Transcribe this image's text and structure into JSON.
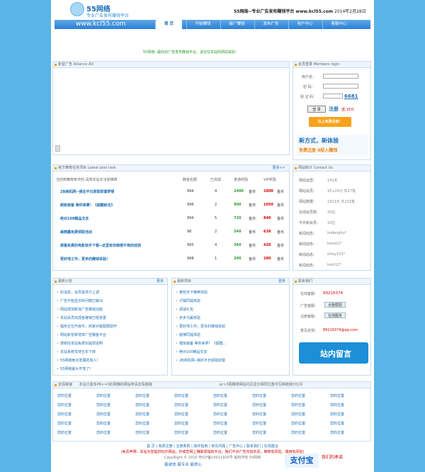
{
  "header": {
    "logo_name": "55网络",
    "logo_slogan": "专业广告发布赚钱平台",
    "tag_strong": "55网络--专业广告发布赚钱平台 www.kcl55.com",
    "tag_date": "2014年2月28日",
    "url": "www.kcl55.com"
  },
  "nav": [
    {
      "label": "首 页",
      "active": true
    },
    {
      "label": "开始赚钱"
    },
    {
      "label": "接广赚钱"
    },
    {
      "label": "发布广告"
    },
    {
      "label": "用户中心"
    },
    {
      "label": "客服中心"
    }
  ],
  "scroll_notice": "55网络--最好的广告发布赚钱平台，请记住本站的网站域名!",
  "new_ads": {
    "title": "新型广告 Alliance AD"
  },
  "login": {
    "title": "会员登录 Members login",
    "username_label": "用户名：",
    "password_label": "密 码：",
    "captcha_label": "验 证 码：",
    "captcha_value": "6681",
    "login_btn": "登 录",
    "register_link": "注册",
    "bonus": "送.15元",
    "free_register_btn": "马上免费注册！",
    "promo_line1": "新方式，新体验",
    "promo_line2": "免费注册 0投入赚钱"
  },
  "tasks": {
    "title": "官方推荐任务项目 Latest post task",
    "more": "更多>>",
    "intro": "当前到推荐条件时,请将本站长当前推荐",
    "headers": [
      "酬金名额",
      "已完成",
      "普通奖励",
      "VIP奖励"
    ],
    "rows": [
      {
        "name": "2B商机网--我在平日获取财富梦想",
        "quota": "994",
        "done": "4",
        "normal": "2400",
        "vip": "2800",
        "unit": "金币"
      },
      {
        "name": "刷枪装备 等你来拿！《超酷射击》",
        "quota": "996",
        "done": "2",
        "normal": "900",
        "vip": "1050",
        "unit": "金币"
      },
      {
        "name": "绝对100精品交友",
        "quota": "994",
        "done": "5",
        "normal": "720",
        "vip": "840",
        "unit": "金币"
      },
      {
        "name": "美丽鑫免费领取活动",
        "quota": "98",
        "done": "2",
        "normal": "540",
        "vip": "630",
        "unit": "金币"
      },
      {
        "name": "想看免费的电影快手下载--这里有你想想不到的收获",
        "quota": "995",
        "done": "4",
        "normal": "360",
        "vip": "420",
        "unit": "金币"
      },
      {
        "name": "更好地工作，更多的赚钱体验！",
        "quota": "998",
        "done": "1",
        "normal": "240",
        "vip": "280",
        "unit": "金币"
      }
    ]
  },
  "stats": {
    "title": "网站统计 Contact Us",
    "rows": [
      {
        "label": "网站运营：",
        "value": "141天"
      },
      {
        "label": "网站会员：",
        "value": "1E+24元 共27笔"
      },
      {
        "label": "网站数据：",
        "value": "2313元 共232笔"
      },
      {
        "label": "在线会员数：",
        "value": "20位"
      },
      {
        "label": "今日新会员：",
        "value": "10位"
      },
      {
        "label": "新闻动态：",
        "value": "leidenghu*"
      },
      {
        "label": "新闻动态：",
        "value": "klaid22*"
      },
      {
        "label": "新闻动态：",
        "value": "shixy102*"
      },
      {
        "label": "新闻动态：",
        "value": "texti12*"
      }
    ]
  },
  "news": {
    "title": "最新公告",
    "more": "更多",
    "items": [
      "好消息，会员需求只上调",
      "广告不能显示的问题已解决",
      "网站增加新加广告赚钱功能",
      "本站会员完成各赚钱已经变更",
      "程序正在升级中，商家对客服帮助开",
      "网站新花新增单广告赚金平台",
      "感谢信本站免费出提现说明",
      "本站系统支持五年下转",
      "55网络绝对发展的加入!",
      "55网络最大开发了!"
    ]
  },
  "projects": {
    "title": "最新项目",
    "more": "更多",
    "items": [
      "某些天下精英体验",
      "讨销同提体验",
      "调适礼包",
      "步步为赢体验",
      "更好地工作，更多的赚钱体验",
      "旋律同提体验",
      "模拟装备 等你来拿！《超酷...",
      "绝对100精品交友",
      "2B商机网--我的平日获取财富"
    ]
  },
  "contact": {
    "title": "联系我们",
    "service_label": "在线客服：",
    "qq": "89216374",
    "ad_label": "广告客服：",
    "qq_btn": "点我帮助",
    "reg_label": "注册客服：",
    "reg_btn": "在线服务",
    "email_label": "意见反馈：",
    "email": "89216374@qq.com",
    "sticker": "站内留言"
  },
  "links": {
    "title": "友情链接",
    "desc": "本站只需多PR>=3的网赚的网站申请友情链接",
    "desc2": "pr>3网赚类网站内页显示相同位置可互换链接3元/月",
    "cell": "您的位置"
  },
  "footer": {
    "links": "首 页 | 免费注册 | 注册条款 | 操作指南 | 常见问题 | 广告中心 | 联系我们 | 在线建议",
    "declaration": "(免责声明：本站为您提供玩乐网站，作成您网上赚取零钱的平台；我们不对广告内容负责，推荐有风险，慎用有风险)",
    "copyright": "CopyRight © 2010 粤ICP备10011920号 版权所有 55网络",
    "slogan": "最诚信 最专业 最放心",
    "alipay": "支付宝",
    "alipay_right": "我们的承诺"
  }
}
